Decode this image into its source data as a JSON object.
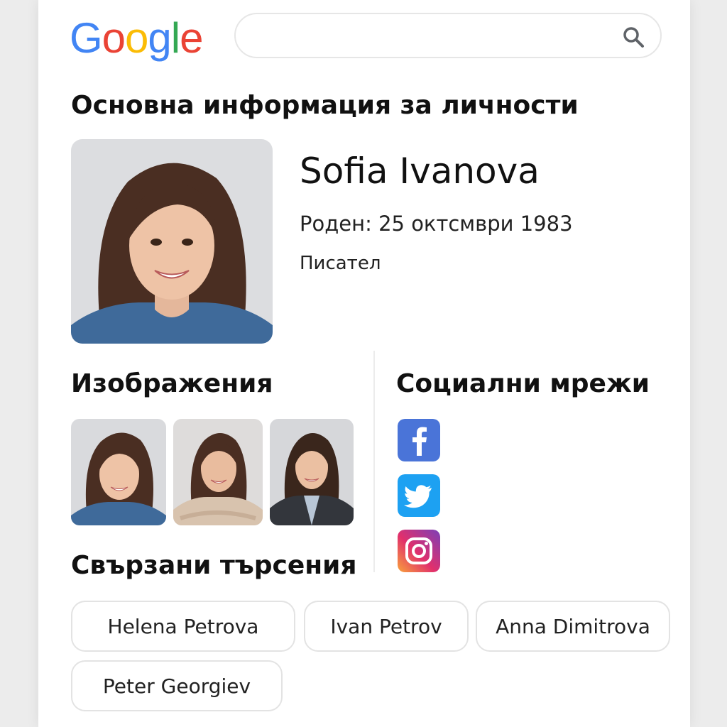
{
  "header": {
    "logo_letters": [
      "G",
      "o",
      "o",
      "g",
      "l",
      "e"
    ],
    "logo_colors": [
      "#4285F4",
      "#EA4335",
      "#FBBC05",
      "#4285F4",
      "#34A853",
      "#EA4335"
    ],
    "search": {
      "value": "",
      "placeholder": ""
    },
    "search_icon": "search-icon"
  },
  "knowledge_panel": {
    "section_title": "Основна информация за личности",
    "name": "Sofia Ivanova",
    "born": "Роден: 25 октсмври 1983",
    "occupation": "Писател"
  },
  "images": {
    "title": "Изображения",
    "thumbnails": [
      {
        "icon": "portrait-denim-shirt"
      },
      {
        "icon": "portrait-beige-sweater"
      },
      {
        "icon": "portrait-dark-blazer"
      }
    ]
  },
  "social": {
    "title": "Социални мрежи",
    "networks": [
      {
        "icon": "facebook-icon",
        "color": "#4A74D8"
      },
      {
        "icon": "twitter-icon",
        "color": "#1DA1F2"
      },
      {
        "icon": "instagram-icon",
        "color": "#D6336C"
      }
    ]
  },
  "related": {
    "title": "Свързани търсения",
    "chips": [
      "Helena Petrova",
      "Ivan Petrov",
      "Anna Dimitrova",
      "Peter Georgiev"
    ]
  }
}
